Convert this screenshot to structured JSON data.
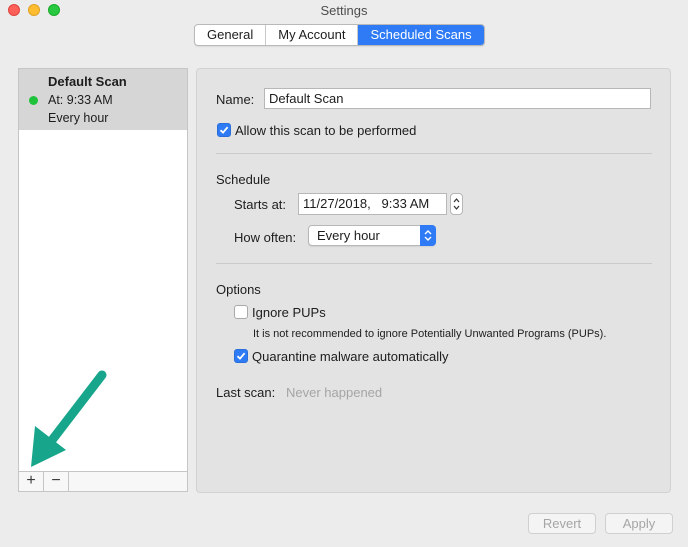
{
  "window": {
    "title": "Settings"
  },
  "tabs": [
    {
      "label": "General"
    },
    {
      "label": "My Account"
    },
    {
      "label": "Scheduled Scans",
      "active": true
    }
  ],
  "scan_list": {
    "items": [
      {
        "name": "Default Scan",
        "time": "At: 9:33 AM",
        "frequency": "Every hour",
        "status": "enabled",
        "status_color": "#1fc23a"
      }
    ],
    "add_label": "+",
    "remove_label": "−"
  },
  "annotation": {
    "arrow_color": "#17a68b",
    "arrow_target": "add-scan-button"
  },
  "settings": {
    "name_label": "Name:",
    "name_value": "Default Scan",
    "allow_label": "Allow this scan to be performed",
    "allow_checked": true,
    "schedule_heading": "Schedule",
    "starts_label": "Starts at:",
    "starts_value": "11/27/2018,   9:33 AM",
    "how_often_label": "How often:",
    "how_often_value": "Every hour",
    "options_heading": "Options",
    "ignore_pups_label": "Ignore PUPs",
    "ignore_pups_checked": false,
    "ignore_pups_note": "It is not recommended to ignore Potentially Unwanted Programs (PUPs).",
    "quarantine_label": "Quarantine malware automatically",
    "quarantine_checked": true,
    "last_scan_label": "Last scan:",
    "last_scan_value": "Never happened"
  },
  "buttons": {
    "revert": "Revert",
    "apply": "Apply"
  },
  "colors": {
    "accent": "#2f7bf5",
    "background": "#ececec"
  }
}
